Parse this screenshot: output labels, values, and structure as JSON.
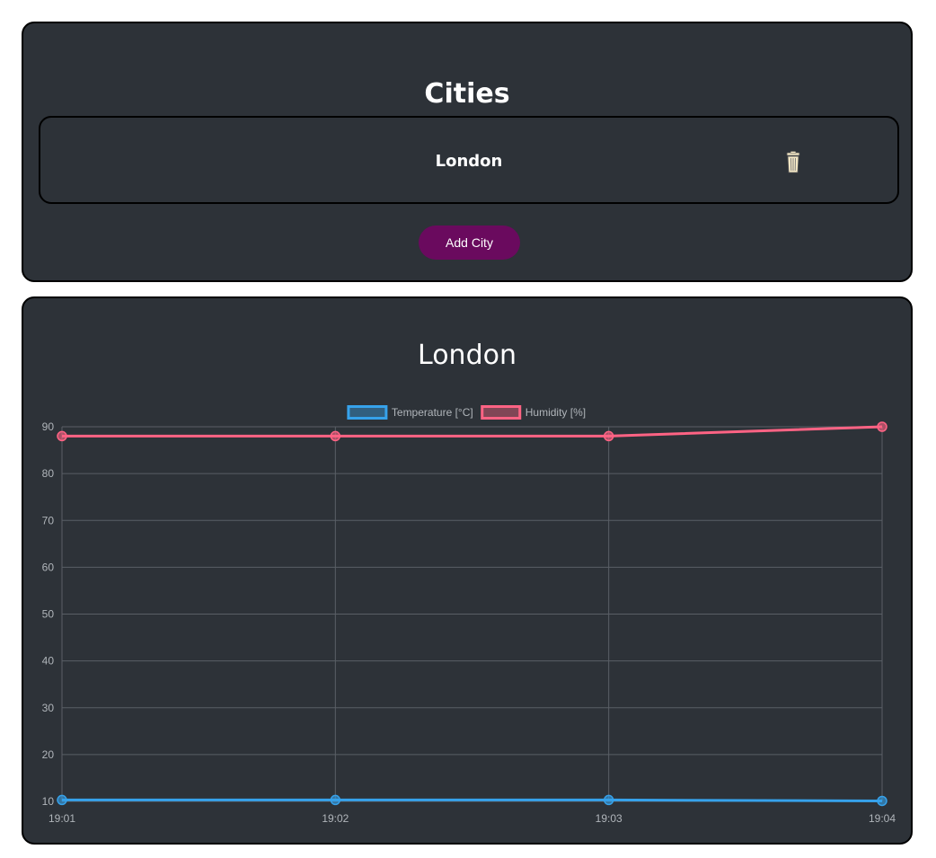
{
  "cities_panel": {
    "title": "Cities",
    "cities": [
      {
        "name": "London"
      }
    ],
    "add_button_label": "Add City"
  },
  "chart_panel": {
    "title": "London"
  },
  "colors": {
    "temperature": "#36a2eb",
    "humidity": "#ff6384",
    "add_button": "#6a0a5e",
    "card_bg": "#2d3238"
  },
  "chart_data": {
    "type": "line",
    "x": [
      "19:01",
      "19:02",
      "19:03",
      "19:04"
    ],
    "ylim": [
      10,
      90
    ],
    "yticks": [
      10,
      20,
      30,
      40,
      50,
      60,
      70,
      80,
      90
    ],
    "grid": true,
    "legend_position": "top",
    "series": [
      {
        "name": "Temperature [°C]",
        "values": [
          10.3,
          10.3,
          10.3,
          10.1
        ]
      },
      {
        "name": "Humidity [%]",
        "values": [
          88,
          88,
          88,
          90
        ]
      }
    ]
  }
}
